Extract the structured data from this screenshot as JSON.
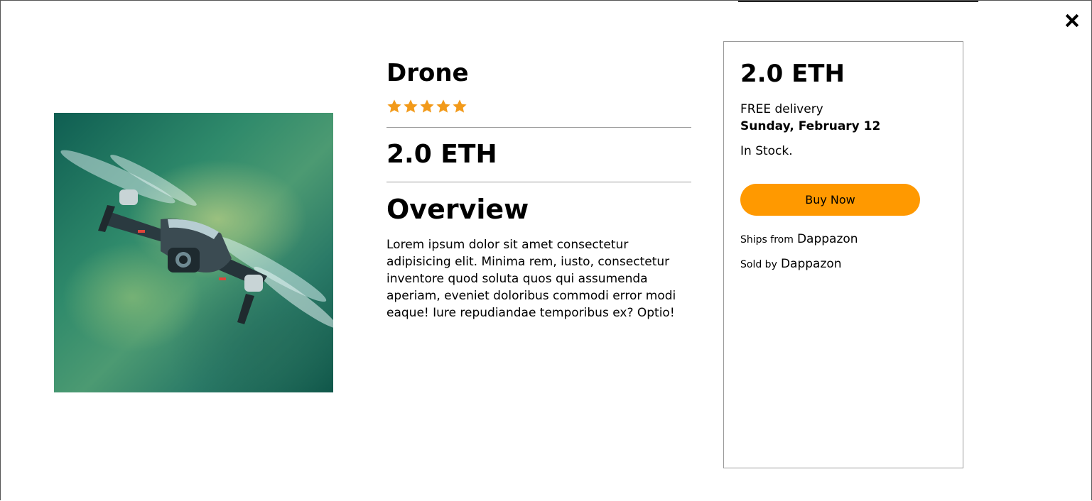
{
  "product": {
    "name": "Drone",
    "rating": 5,
    "price": "2.0 ETH",
    "overview_heading": "Overview",
    "description": "Lorem ipsum dolor sit amet consectetur adipisicing elit. Minima rem, iusto, consectetur inventore quod soluta quos qui assumenda aperiam, eveniet doloribus commodi error modi eaque! Iure repudiandae temporibus ex? Optio!"
  },
  "buy_card": {
    "price": "2.0 ETH",
    "delivery_label": "FREE delivery",
    "delivery_date": "Sunday, February 12",
    "stock": "In Stock.",
    "buy_label": "Buy Now",
    "ships_from_label": "Ships from",
    "ships_from_value": "Dappazon",
    "sold_by_label": "Sold by",
    "sold_by_value": "Dappazon"
  },
  "icons": {
    "close": "close-icon",
    "star": "star-icon"
  },
  "colors": {
    "accent": "#ff9900",
    "star": "#f29a1a",
    "border": "#9a9a9a"
  }
}
